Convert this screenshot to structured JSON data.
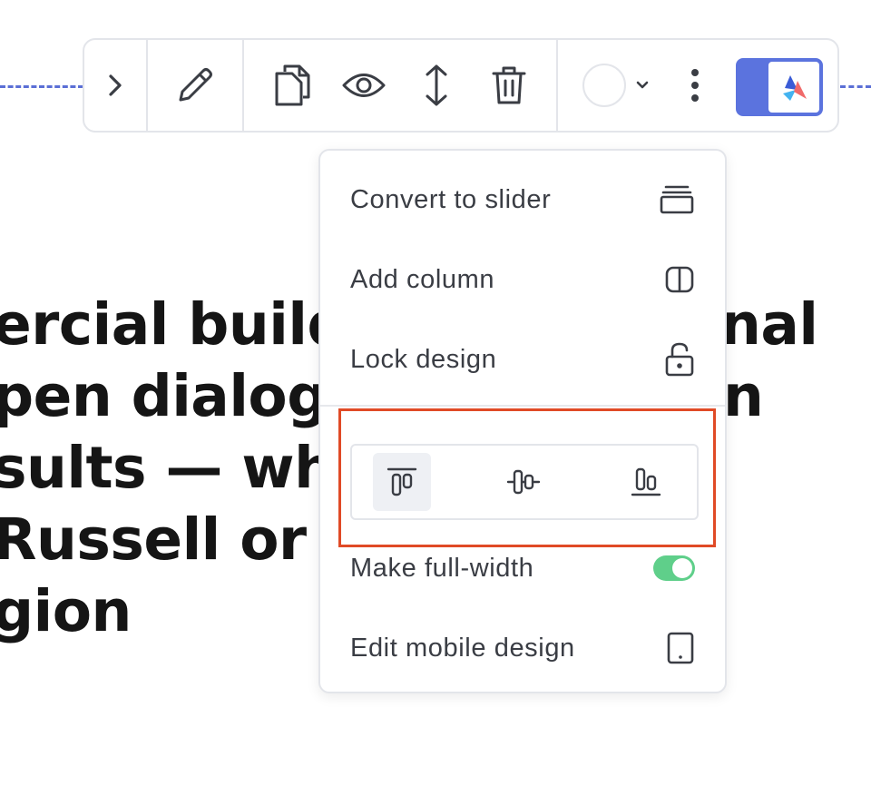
{
  "toolbar": {
    "buttons": [
      {
        "name": "collapse-button",
        "icon": "chevron-right-icon"
      },
      {
        "name": "edit-button",
        "icon": "pencil-icon"
      },
      {
        "name": "duplicate-button",
        "icon": "copy-icon"
      },
      {
        "name": "visibility-button",
        "icon": "eye-icon"
      },
      {
        "name": "move-button",
        "icon": "vertical-arrows-icon"
      },
      {
        "name": "delete-button",
        "icon": "trash-icon"
      },
      {
        "name": "color-button",
        "icon": "color-swatch"
      },
      {
        "name": "more-button",
        "icon": "kebab-icon"
      },
      {
        "name": "ai-assistant-button",
        "icon": "ai-logo-icon"
      }
    ],
    "accent_color": "#5b73de"
  },
  "background_text": {
    "lines": [
      "ercial build r",
      "pen dialogue",
      "sults — whet",
      " Russell or t",
      "gion"
    ],
    "right_fragments": [
      "nal",
      "n"
    ]
  },
  "menu": {
    "items": [
      {
        "label": "Convert to slider",
        "icon": "slider-stack-icon"
      },
      {
        "label": "Add column",
        "icon": "column-icon"
      },
      {
        "label": "Lock design",
        "icon": "unlock-icon"
      }
    ],
    "alignment": {
      "options": [
        {
          "name": "align-top",
          "icon": "align-top-icon",
          "active": true
        },
        {
          "name": "align-middle",
          "icon": "align-middle-icon",
          "active": false
        },
        {
          "name": "align-bottom",
          "icon": "align-bottom-icon",
          "active": false
        }
      ]
    },
    "full_width": {
      "label": "Make full-width",
      "enabled": true,
      "toggle_color": "#5fcf8a"
    },
    "mobile": {
      "label": "Edit mobile design",
      "icon": "phone-icon"
    }
  },
  "highlight_color": "#e04a26"
}
